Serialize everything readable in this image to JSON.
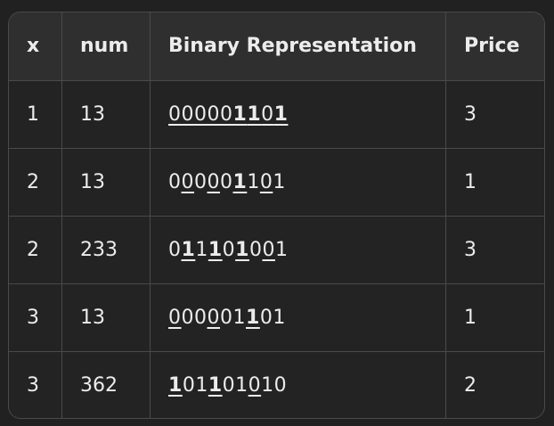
{
  "table": {
    "headers": [
      "x",
      "num",
      "Binary Representation",
      "Price"
    ],
    "rows": [
      {
        "x": "1",
        "num": "13",
        "binary": "000001101",
        "price": "3",
        "underline": [
          0,
          1,
          2,
          3,
          4,
          5,
          6,
          7,
          8
        ],
        "bold": [
          5,
          6,
          8
        ]
      },
      {
        "x": "2",
        "num": "13",
        "binary": "000001101",
        "price": "1",
        "underline": [
          1,
          3,
          5,
          7
        ],
        "bold": [
          5
        ]
      },
      {
        "x": "2",
        "num": "233",
        "binary": "011101001",
        "price": "3",
        "underline": [
          1,
          3,
          5,
          7
        ],
        "bold": [
          1,
          3,
          5
        ]
      },
      {
        "x": "3",
        "num": "13",
        "binary": "000001101",
        "price": "1",
        "underline": [
          0,
          3,
          6
        ],
        "bold": [
          6
        ]
      },
      {
        "x": "3",
        "num": "362",
        "binary": "101101010",
        "price": "2",
        "underline": [
          0,
          3,
          6
        ],
        "bold": [
          0,
          3
        ]
      }
    ]
  }
}
